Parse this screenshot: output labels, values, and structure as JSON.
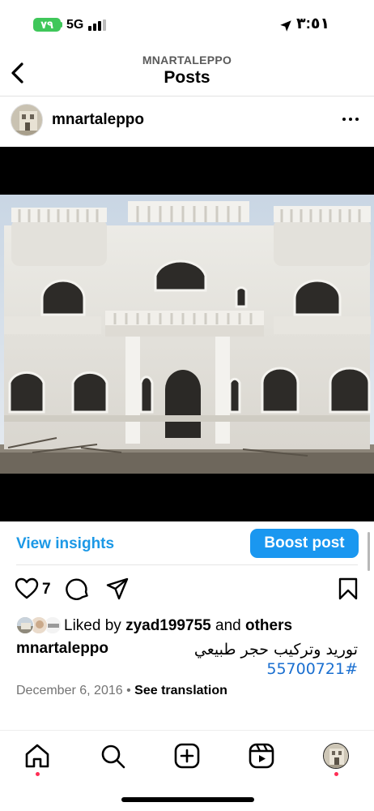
{
  "status_bar": {
    "battery": "٧٩",
    "network": "5G",
    "time": "٣:٥١"
  },
  "header": {
    "account": "MNARTALEPPO",
    "title": "Posts"
  },
  "post": {
    "username": "mnartaleppo",
    "like_count": "7",
    "likes": {
      "prefix": "Liked by",
      "user": "zyad199755",
      "conjunction": "and",
      "others": "others"
    },
    "caption": {
      "user": "mnartaleppo",
      "text": "توريد وتركيب حجر طبيعي",
      "hashtag": "#55700721"
    },
    "date": "December 6, 2016",
    "separator": "•",
    "see_translation": "See translation"
  },
  "insights": {
    "view_label": "View insights",
    "boost_label": "Boost post"
  },
  "colors": {
    "accent": "#1a97f0",
    "link": "#1b98e6",
    "hashtag": "#1a6fd0",
    "battery": "#3fc75a",
    "notification_dot": "#ff2d55"
  },
  "icons": [
    "back-chevron-icon",
    "more-icon",
    "heart-icon",
    "comment-icon",
    "share-icon",
    "bookmark-icon",
    "home-icon",
    "search-icon",
    "create-icon",
    "reels-icon",
    "location-arrow-icon",
    "signal-icon"
  ]
}
